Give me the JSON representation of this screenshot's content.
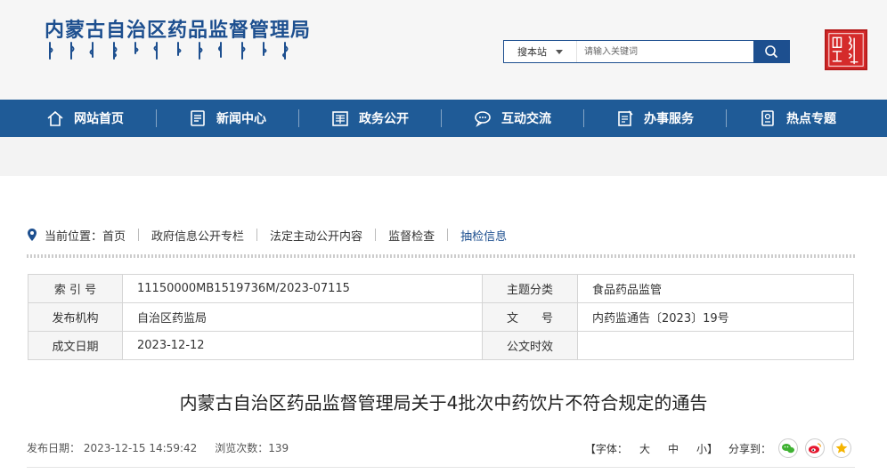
{
  "header": {
    "title": "内蒙古自治区药品监督管理局",
    "search": {
      "scope": "搜本站",
      "placeholder": "请输入关键词"
    }
  },
  "nav": [
    {
      "label": "网站首页",
      "icon": "home-icon"
    },
    {
      "label": "新闻中心",
      "icon": "news-icon"
    },
    {
      "label": "政务公开",
      "icon": "document-icon"
    },
    {
      "label": "互动交流",
      "icon": "chat-icon"
    },
    {
      "label": "办事服务",
      "icon": "form-icon"
    },
    {
      "label": "热点专题",
      "icon": "topic-icon"
    }
  ],
  "breadcrumb": {
    "prefix": "当前位置：",
    "items": [
      "首页",
      "政府信息公开专栏",
      "法定主动公开内容",
      "监督检查",
      "抽检信息"
    ]
  },
  "meta": {
    "rows": [
      {
        "k1": "索 引 号",
        "v1": "11150000MB1519736M/2023-07115",
        "k2": "主题分类",
        "v2": "食品药品监管"
      },
      {
        "k1": "发布机构",
        "v1": "自治区药监局",
        "k2": "文　　号",
        "v2": "内药监通告〔2023〕19号"
      },
      {
        "k1": "成文日期",
        "v1": "2023-12-12",
        "k2": "公文时效",
        "v2": ""
      }
    ]
  },
  "article": {
    "title": "内蒙古自治区药品监督管理局关于4批次中药饮片不符合规定的通告",
    "publish_date": "发布日期： 2023-12-15 14:59:42",
    "views": "浏览次数：139"
  },
  "tools": {
    "font_label": "【字体：",
    "font_large": "大",
    "font_medium": "中",
    "font_small": "小】",
    "share_label": "分享到："
  },
  "colors": {
    "brand": "#1f5b97",
    "seal": "#d52b2b"
  }
}
